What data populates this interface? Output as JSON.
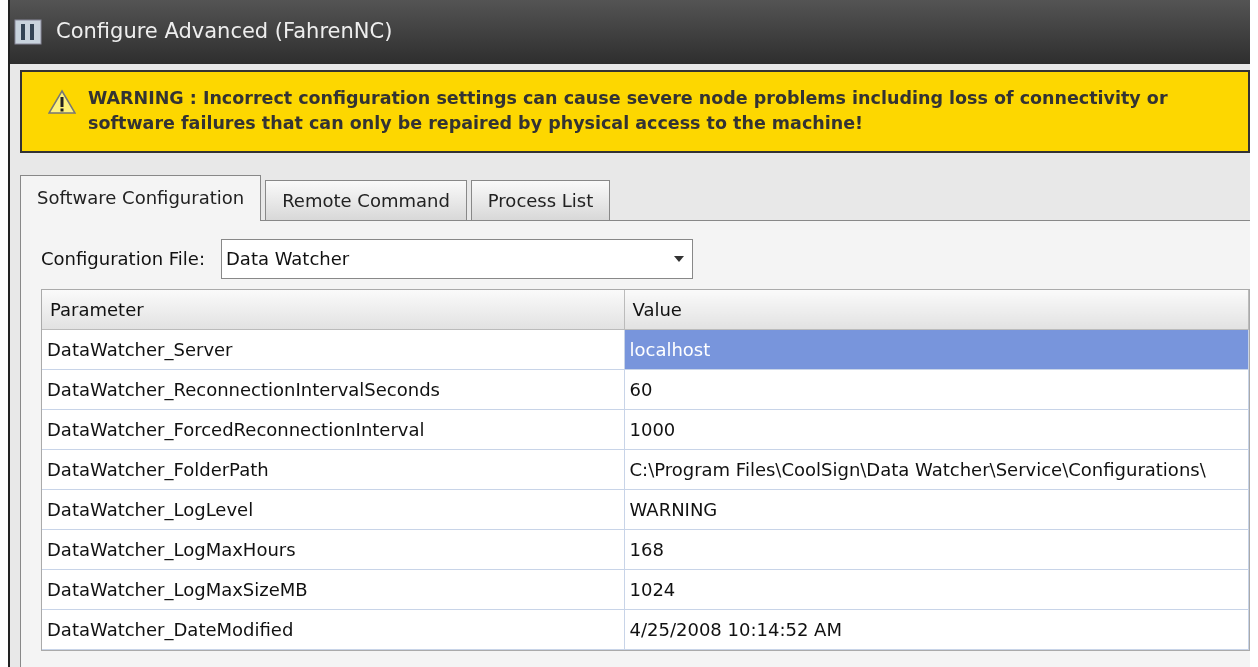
{
  "window": {
    "title": "Configure Advanced (FahrenNC)"
  },
  "warning": {
    "text": "WARNING : Incorrect configuration settings can cause severe node problems including loss of connectivity or software failures that can only be repaired by physical access to the machine!"
  },
  "tabs": [
    {
      "label": "Software Configuration",
      "selected": true
    },
    {
      "label": "Remote Command",
      "selected": false
    },
    {
      "label": "Process List",
      "selected": false
    }
  ],
  "config_file": {
    "label": "Configuration File:",
    "value": "Data Watcher"
  },
  "table": {
    "columns": [
      "Parameter",
      "Value"
    ],
    "rows": [
      {
        "parameter": "DataWatcher_Server",
        "value": "localhost",
        "selected": true
      },
      {
        "parameter": "DataWatcher_ReconnectionIntervalSeconds",
        "value": "60",
        "selected": false
      },
      {
        "parameter": "DataWatcher_ForcedReconnectionInterval",
        "value": "1000",
        "selected": false
      },
      {
        "parameter": "DataWatcher_FolderPath",
        "value": "C:\\Program Files\\CoolSign\\Data Watcher\\Service\\Configurations\\",
        "selected": false
      },
      {
        "parameter": "DataWatcher_LogLevel",
        "value": "WARNING",
        "selected": false
      },
      {
        "parameter": "DataWatcher_LogMaxHours",
        "value": "168",
        "selected": false
      },
      {
        "parameter": "DataWatcher_LogMaxSizeMB",
        "value": "1024",
        "selected": false
      },
      {
        "parameter": "DataWatcher_DateModified",
        "value": "4/25/2008 10:14:52 AM",
        "selected": false
      }
    ]
  }
}
